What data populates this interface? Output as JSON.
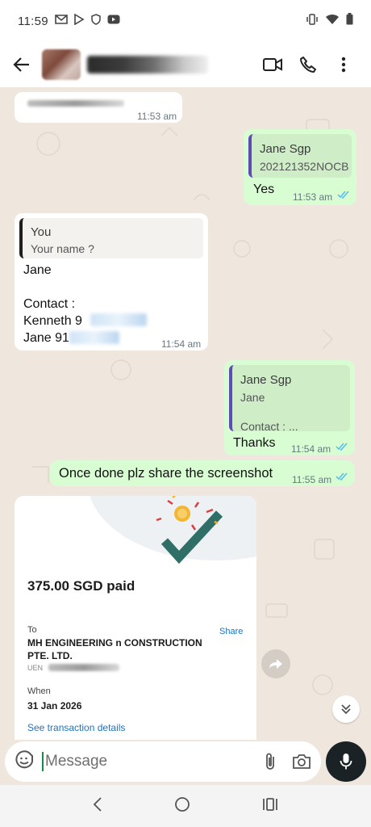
{
  "status_bar": {
    "time": "11:59"
  },
  "header": {
    "title": ""
  },
  "messages": [
    {
      "direction": "in",
      "text": "",
      "time": "11:53 am"
    },
    {
      "direction": "out",
      "quote_name": "Jane Sgp",
      "quote_text": "202121352NOCB",
      "text": "Yes",
      "time": "11:53 am"
    },
    {
      "direction": "in",
      "quote_name": "You",
      "quote_text": "Your name ?",
      "lines": [
        "Jane",
        "",
        "Contact :",
        "Kenneth 9",
        "Jane 91"
      ],
      "time": "11:54 am"
    },
    {
      "direction": "out",
      "quote_name": "Jane Sgp",
      "quote_lines": [
        "Jane",
        "",
        "Contact : ..."
      ],
      "text": "Thanks",
      "time": "11:54 am"
    },
    {
      "direction": "out",
      "text": "Once done plz share the screenshot",
      "time": "11:55 am"
    }
  ],
  "receipt": {
    "amount": "375.00 SGD paid",
    "to_label": "To",
    "recipient": "MH ENGINEERING n CONSTRUCTION PTE. LTD.",
    "uen_prefix": "UEN",
    "share_label": "Share",
    "when_label": "When",
    "date": "31 Jan 2026",
    "details_link": "See transaction details"
  },
  "composer": {
    "placeholder": "Message"
  },
  "colors": {
    "outgoing_bubble": "#d9fdd3",
    "incoming_bubble": "#ffffff",
    "read_ticks": "#53bdeb",
    "chat_background": "#efe7de",
    "receipt_check": "#2f6f67"
  }
}
